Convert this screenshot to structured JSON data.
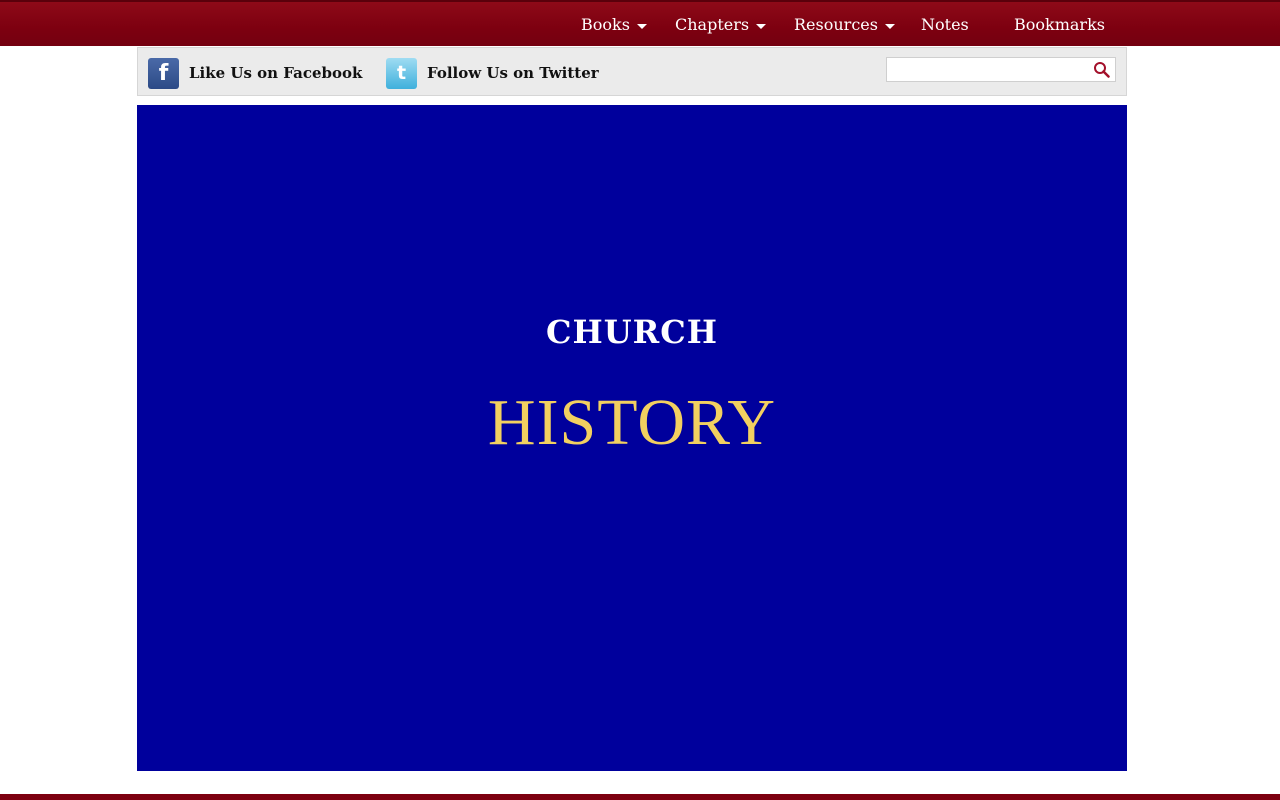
{
  "nav": {
    "books": "Books",
    "chapters": "Chapters",
    "resources": "Resources",
    "notes": "Notes",
    "bookmarks": "Bookmarks"
  },
  "social": {
    "facebook_label": "Like Us on Facebook",
    "facebook_icon_glyph": "f",
    "twitter_label": "Follow Us on Twitter",
    "twitter_icon_glyph": "t"
  },
  "search": {
    "value": "",
    "placeholder": ""
  },
  "hero": {
    "line1": "CHURCH",
    "line2": "HISTORY"
  },
  "colors": {
    "topbar": "#7d0010",
    "hero_background": "#00009c",
    "hero_accent": "#f2d060"
  }
}
